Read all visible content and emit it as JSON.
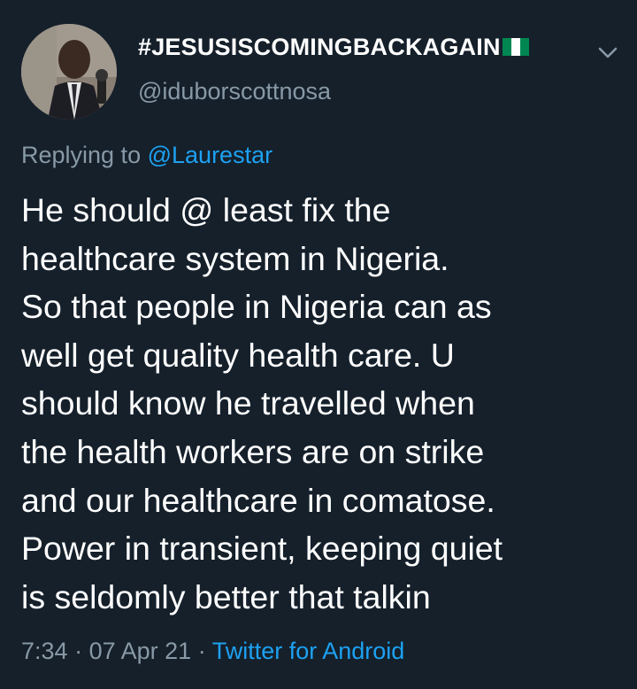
{
  "user": {
    "display_name": "#JESUSISCOMINGBACKAGAIN",
    "flag_icon": "nigeria-flag-icon",
    "handle": "@iduborscottnosa"
  },
  "reply": {
    "prefix": "Replying to",
    "mention": "@Laurestar"
  },
  "tweet": {
    "text": "He should @ least fix the\nhealthcare system in Nigeria.\nSo that people in Nigeria can as\nwell get quality health care. U\nshould know he travelled when\nthe health workers are on strike\nand our healthcare in comatose.\nPower in transient, keeping quiet\nis seldomly better that talkin"
  },
  "meta": {
    "time": "7:34",
    "separator": "·",
    "date": "07 Apr 21",
    "source": "Twitter for Android"
  },
  "icons": {
    "more": "chevron-down-icon"
  },
  "colors": {
    "background": "#15202b",
    "secondary_text": "#8899a6",
    "accent": "#1da1f2",
    "flag_green": "#008751"
  }
}
